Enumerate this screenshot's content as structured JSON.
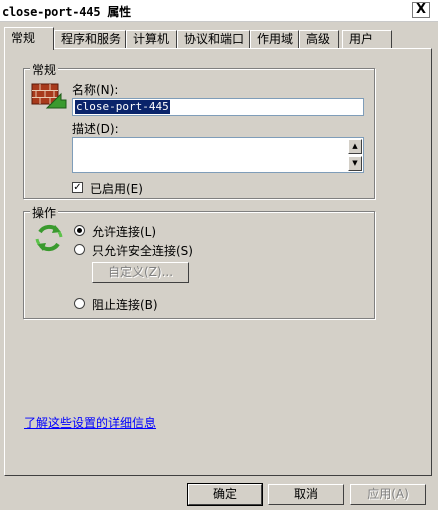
{
  "window": {
    "title": "close-port-445 属性",
    "close_glyph": "X"
  },
  "tabs": [
    {
      "label": "常规",
      "active": true
    },
    {
      "label": "程序和服务",
      "active": false
    },
    {
      "label": "计算机",
      "active": false
    },
    {
      "label": "协议和端口",
      "active": false
    },
    {
      "label": "作用域",
      "active": false
    },
    {
      "label": "高级",
      "active": false
    },
    {
      "label": "用户",
      "active": false
    }
  ],
  "general": {
    "group_label": "常规",
    "icon": "firewall-brick-icon",
    "name_label": "名称(N):",
    "name_value": "close-port-445",
    "description_label": "描述(D):",
    "description_value": "",
    "enabled_label": "已启用(E)",
    "enabled_checked": true
  },
  "action": {
    "group_label": "操作",
    "icon": "refresh-arrows-icon",
    "allow_label": "允许连接(L)",
    "secure_label": "只允许安全连接(S)",
    "customize_label": "自定义(Z)...",
    "block_label": "阻止连接(B)",
    "selected": "allow"
  },
  "link_text": "了解这些设置的详细信息",
  "buttons": {
    "ok": "确定",
    "cancel": "取消",
    "apply": "应用(A)"
  },
  "colors": {
    "selection": "#0a246a",
    "link": "#0000ff",
    "face": "#d4d0c8",
    "icon_green": "#3a9a2e",
    "brick": "#a83a1c"
  }
}
